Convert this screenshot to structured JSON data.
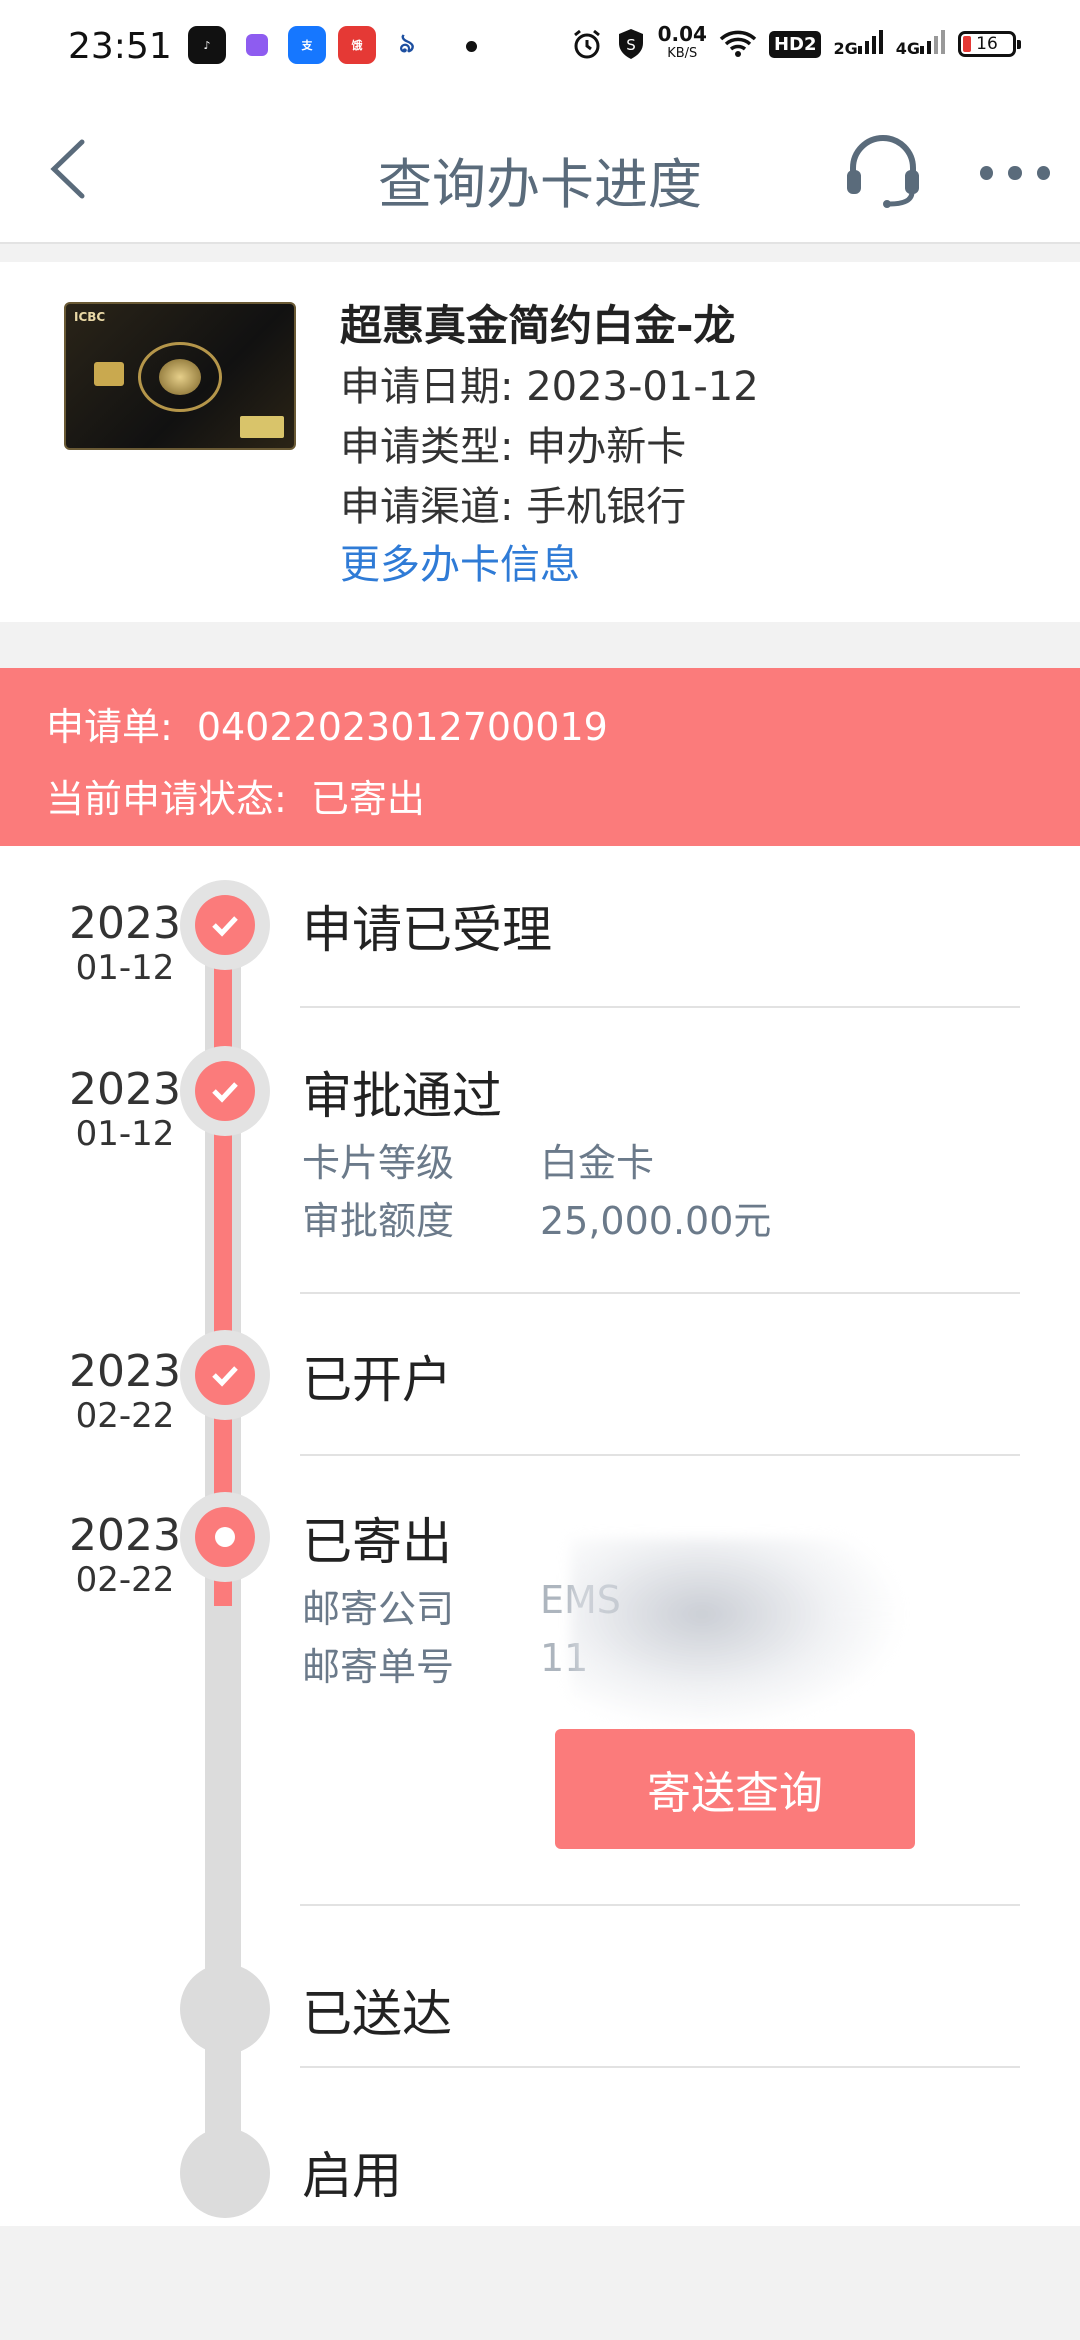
{
  "status_bar": {
    "time": "23:51",
    "speed_value": "0.04",
    "speed_unit": "KB/S",
    "hd_label": "HD2",
    "sig1": "2G",
    "sig2": "4G",
    "battery": "16",
    "icons": [
      "tiktok-icon",
      "messenger-icon",
      "alipay-icon",
      "ele-icon",
      "app-icon",
      "alarm-icon",
      "shield-icon",
      "wifi-icon"
    ]
  },
  "nav": {
    "title": "查询办卡进度",
    "icons": [
      "back-arrow-icon",
      "headset-icon",
      "more-icon"
    ]
  },
  "card": {
    "name": "超惠真金简约白金-龙",
    "apply_date_label": "申请日期:",
    "apply_date": "2023-01-12",
    "apply_type_label": "申请类型:",
    "apply_type": "申办新卡",
    "apply_channel_label": "申请渠道:",
    "apply_channel": "手机银行",
    "more_link": "更多办卡信息",
    "logo_text": "ICBC"
  },
  "banner": {
    "order_label": "申请单:",
    "order_no": "04022023012700019",
    "status_label": "当前申请状态:",
    "status": "已寄出",
    "color": "#fb7b7b"
  },
  "timeline": {
    "steps": [
      {
        "year": "2023",
        "md": "01-12",
        "title": "申请已受理",
        "state": "done"
      },
      {
        "year": "2023",
        "md": "01-12",
        "title": "审批通过",
        "state": "done",
        "details": [
          {
            "label": "卡片等级",
            "value": "白金卡"
          },
          {
            "label": "审批额度",
            "value": "25,000.00元"
          }
        ]
      },
      {
        "year": "2023",
        "md": "02-22",
        "title": "已开户",
        "state": "done"
      },
      {
        "year": "2023",
        "md": "02-22",
        "title": "已寄出",
        "state": "current",
        "details": [
          {
            "label": "邮寄公司",
            "value": "EMS"
          },
          {
            "label": "邮寄单号",
            "value": "11"
          }
        ],
        "button": "寄送查询"
      },
      {
        "year": "",
        "md": "",
        "title": "已送达",
        "state": "pending"
      },
      {
        "year": "",
        "md": "",
        "title": "启用",
        "state": "pending"
      }
    ]
  }
}
